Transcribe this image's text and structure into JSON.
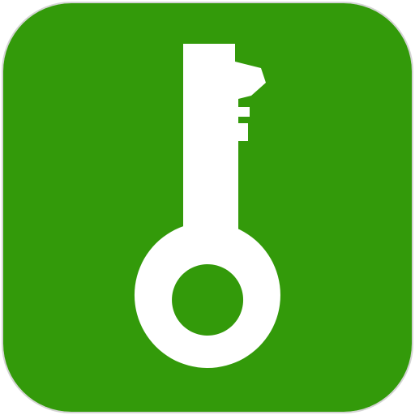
{
  "app_icon": {
    "icon": "key-icon",
    "background_color": "#339a0a",
    "glyph_color": "#ffffff",
    "border_color": "#d4d4d4"
  }
}
